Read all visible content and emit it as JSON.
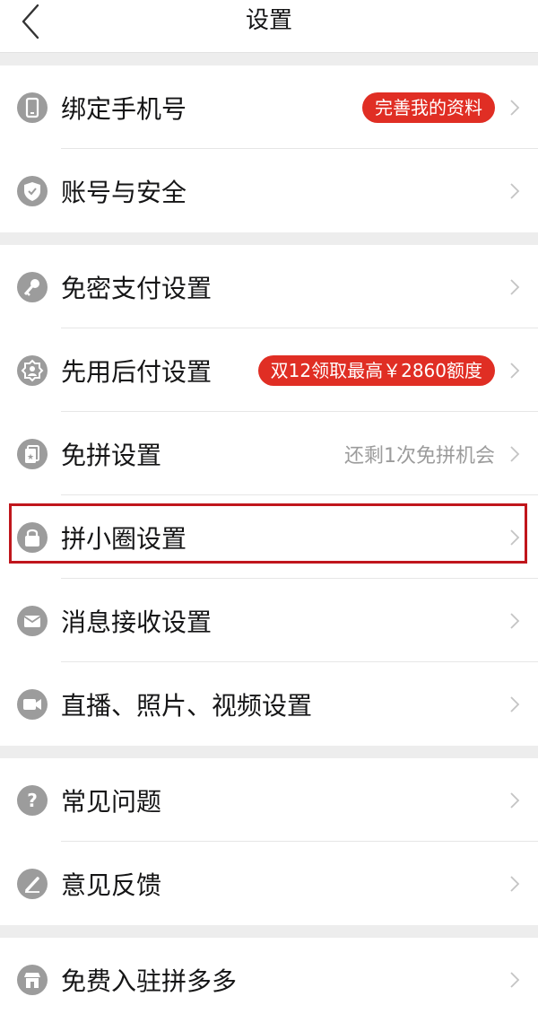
{
  "header": {
    "title": "设置"
  },
  "groups": [
    {
      "rows": [
        {
          "label": "绑定手机号",
          "badge": "完善我的资料",
          "icon": "phone-icon"
        },
        {
          "label": "账号与安全",
          "icon": "shield-icon"
        }
      ]
    },
    {
      "rows": [
        {
          "label": "免密支付设置",
          "icon": "key-icon"
        },
        {
          "label": "先用后付设置",
          "badge": "双12领取最高￥2860额度",
          "icon": "badge-icon"
        },
        {
          "label": "免拼设置",
          "hint": "还剩1次免拼机会",
          "icon": "card-star-icon"
        },
        {
          "label": "拼小圈设置",
          "icon": "lock-icon"
        },
        {
          "label": "消息接收设置",
          "icon": "mail-icon"
        },
        {
          "label": "直播、照片、视频设置",
          "icon": "video-icon"
        }
      ]
    },
    {
      "rows": [
        {
          "label": "常见问题",
          "icon": "question-icon"
        },
        {
          "label": "意见反馈",
          "icon": "pencil-icon"
        }
      ]
    },
    {
      "rows": [
        {
          "label": "免费入驻拼多多",
          "icon": "store-icon"
        }
      ]
    }
  ],
  "colors": {
    "badge": "#e02e24",
    "icon_bg": "#9c9c9c",
    "highlight": "#c0161c"
  }
}
